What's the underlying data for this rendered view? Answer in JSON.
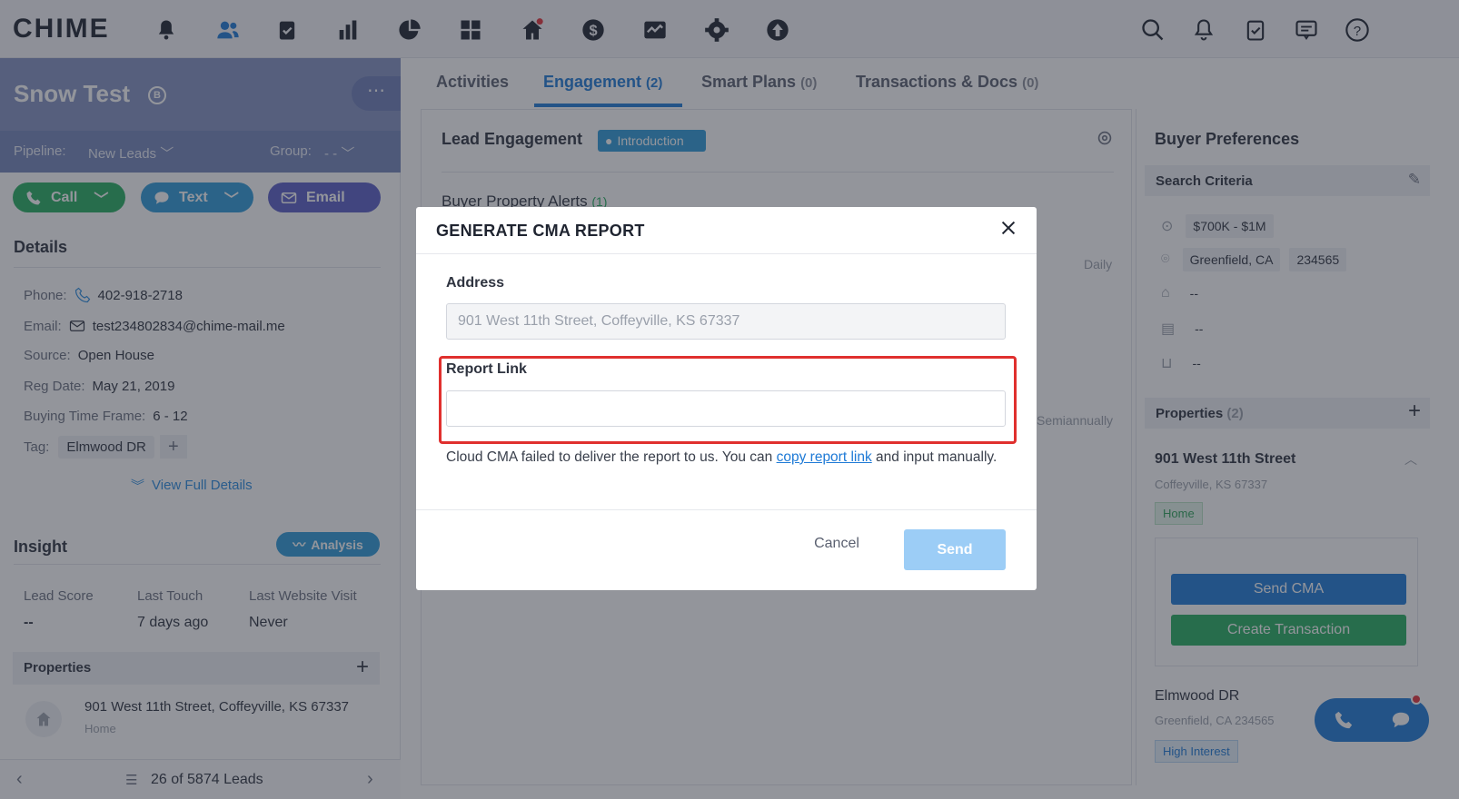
{
  "app": {
    "logo": "CHIME"
  },
  "topnav": {
    "icons": [
      "bell-icon",
      "people-icon",
      "clipboard-icon",
      "bar-chart-icon",
      "pie-chart-icon",
      "grid-icon",
      "home-icon",
      "dollar-icon",
      "activity-icon",
      "gear-icon",
      "upload-icon"
    ],
    "right_icons": [
      "search-icon",
      "bell-icon",
      "clipboard-icon",
      "message-icon",
      "help-icon"
    ]
  },
  "lead": {
    "name": "Snow Test",
    "pipeline_label": "Pipeline:",
    "pipeline_value": "New Leads",
    "group_label": "Group:",
    "group_value": "- -",
    "call": "Call",
    "text": "Text",
    "email": "Email"
  },
  "details": {
    "title": "Details",
    "phone_label": "Phone:",
    "phone": "402-918-2718",
    "email_label": "Email:",
    "email": "test234802834@chime-mail.me",
    "source_label": "Source:",
    "source": "Open House",
    "reg_label": "Reg Date:",
    "reg": "May 21, 2019",
    "btf_label": "Buying Time Frame:",
    "btf": "6 - 12",
    "tag_label": "Tag:",
    "tag": "Elmwood DR",
    "tag_add": "+",
    "view_full": "View Full Details"
  },
  "insight": {
    "title": "Insight",
    "analysis": "Analysis",
    "lead_score_label": "Lead Score",
    "lead_score": "--",
    "last_touch_label": "Last Touch",
    "last_touch": "7 days ago",
    "last_visit_label": "Last Website Visit",
    "last_visit": "Never"
  },
  "left_properties": {
    "title": "Properties",
    "add": "+",
    "address": "901 West 11th Street, Coffeyville, KS 67337",
    "type": "Home"
  },
  "pager": {
    "text": "26 of 5874 Leads"
  },
  "tabs": [
    {
      "label": "Activities",
      "count": ""
    },
    {
      "label": "Engagement",
      "count": "(2)"
    },
    {
      "label": "Smart Plans",
      "count": "(0)"
    },
    {
      "label": "Transactions & Docs",
      "count": "(0)"
    }
  ],
  "engagement": {
    "title": "Lead Engagement",
    "intro": "Introduction",
    "alerts": "Buyer Property Alerts",
    "alerts_count": "(1)",
    "freq1": "Daily",
    "freq2": "Semiannually"
  },
  "buyer": {
    "title": "Buyer Preferences",
    "criteria": "Search Criteria",
    "price": "$700K - $1M",
    "city": "Greenfield, CA",
    "zip": "234565",
    "dash": "--",
    "properties_label": "Properties",
    "properties_count": "(2)",
    "properties_add": "+",
    "prop1_title": "901 West 11th Street",
    "prop1_sub": "Coffeyville, KS 67337",
    "prop1_chip": "Home",
    "send_cma": "Send CMA",
    "create_tx": "Create Transaction",
    "prop2_title": "Elmwood DR",
    "prop2_sub": "Greenfield, CA 234565",
    "prop2_chip": "High Interest"
  },
  "modal": {
    "title": "GENERATE CMA REPORT",
    "address_label": "Address",
    "address_value": "901 West 11th Street, Coffeyville, KS 67337",
    "report_label": "Report Link",
    "report_value": "",
    "help_before": "Cloud CMA failed to deliver the report to us. You can ",
    "help_link": "copy report link",
    "help_after": " and input manually.",
    "cancel": "Cancel",
    "send": "Send"
  },
  "colors": {
    "accent": "#1e7ad6",
    "call": "#27ae60",
    "text": "#2e9bd9",
    "email": "#5b5fc7",
    "highlight": "#e0302e",
    "send_disabled": "#9ccdf6"
  }
}
